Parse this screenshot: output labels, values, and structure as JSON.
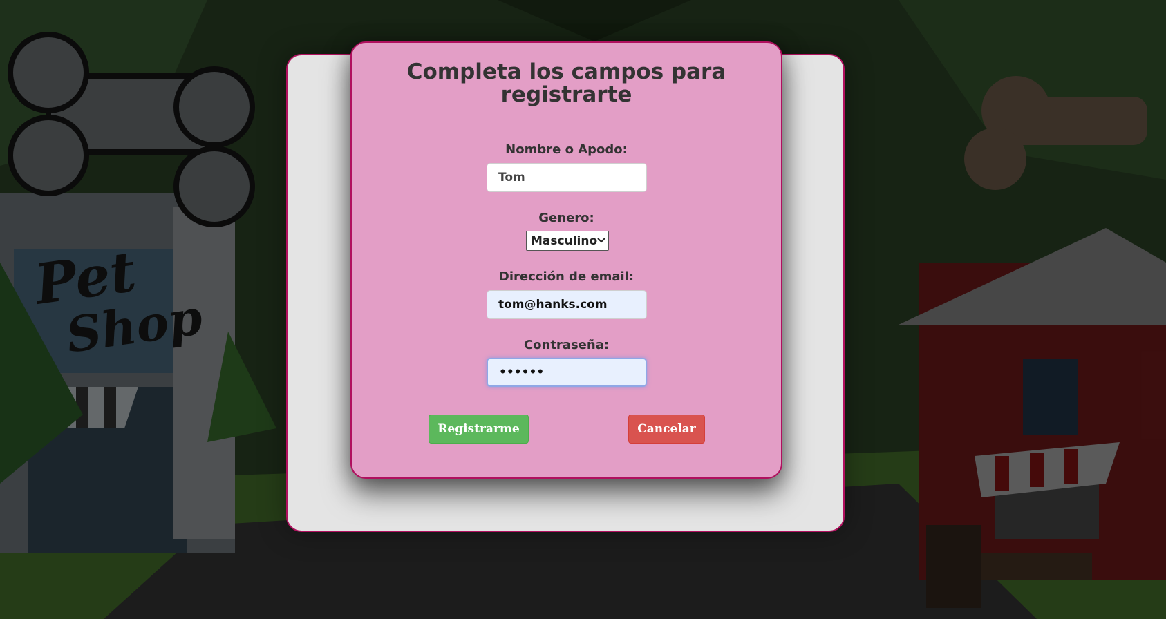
{
  "form": {
    "title": "Completa los campos para registrarte",
    "name_label": "Nombre o Apodo:",
    "name_value": "Tom",
    "gender_label": "Genero:",
    "gender_selected": "Masculino",
    "email_label": "Dirección de email:",
    "email_value": "tom@hanks.com",
    "password_label": "Contraseña:",
    "password_masked": "••••••",
    "register_button": "Registrarme",
    "cancel_button": "Cancelar"
  },
  "background": {
    "sign_line1": "Pet",
    "sign_line2": "Shop"
  },
  "icons": {
    "dropdown": "chevron-down-icon"
  },
  "colors": {
    "card_pink": "#e39ec6",
    "card_border": "#b0105e",
    "register_green": "#5cb85c",
    "cancel_red": "#d9534f"
  }
}
